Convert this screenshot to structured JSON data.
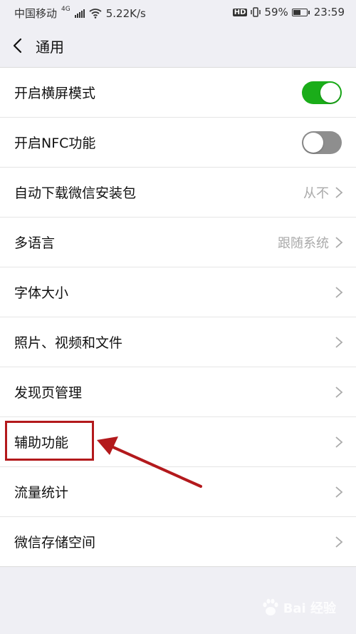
{
  "status_bar": {
    "carrier": "中国移动",
    "network_type": "4G",
    "speed": "5.22K/s",
    "hd": "HD",
    "battery": "59%",
    "battery_level": 0.59,
    "time": "23:59"
  },
  "nav": {
    "title": "通用"
  },
  "items": [
    {
      "label": "开启横屏模式",
      "toggle": "on"
    },
    {
      "label": "开启NFC功能",
      "toggle": "off"
    },
    {
      "label": "自动下载微信安装包",
      "value": "从不"
    },
    {
      "label": "多语言",
      "value": "跟随系统"
    },
    {
      "label": "字体大小"
    },
    {
      "label": "照片、视频和文件"
    },
    {
      "label": "发现页管理"
    },
    {
      "label": "辅助功能"
    },
    {
      "label": "流量统计"
    },
    {
      "label": "微信存储空间"
    }
  ],
  "colors": {
    "toggle_on": "#1aad19",
    "toggle_off": "#8e8e8e",
    "annotation": "#b3191c",
    "background": "#efeff4"
  },
  "annotation": {
    "highlighted_item": "辅助功能"
  },
  "watermark": {
    "text": "Bai 经验"
  }
}
